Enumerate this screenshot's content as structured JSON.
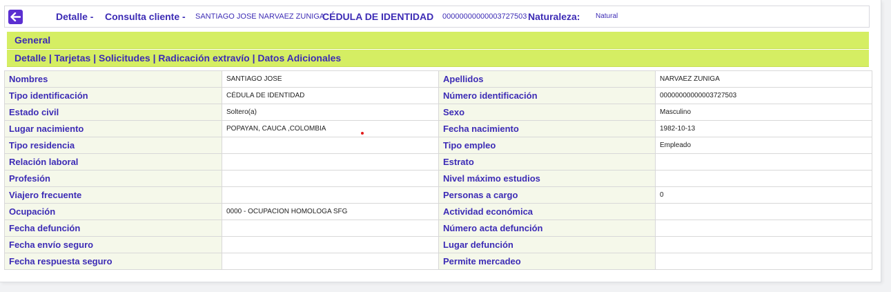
{
  "header": {
    "detalle": "Detalle -",
    "consulta": "Consulta cliente -",
    "client_name": "SANTIAGO JOSE NARVAEZ ZUNIGA",
    "doc_type": "CÉDULA DE IDENTIDAD",
    "doc_number": "00000000000003727503",
    "naturaleza_label": "Naturaleza:",
    "naturaleza_value": "Natural"
  },
  "sections": {
    "general": "General",
    "tabs": [
      "Detalle",
      "Tarjetas",
      "Solicitudes",
      "Radicación extravío",
      "Datos Adicionales"
    ],
    "separator": "|"
  },
  "rows": [
    {
      "l1": "Nombres",
      "v1": "SANTIAGO JOSE",
      "l2": "Apellidos",
      "v2": "NARVAEZ ZUNIGA"
    },
    {
      "l1": "Tipo identificación",
      "v1": "CÉDULA DE IDENTIDAD",
      "l2": "Número identificación",
      "v2": "00000000000003727503"
    },
    {
      "l1": "Estado civil",
      "v1": "Soltero(a)",
      "l2": "Sexo",
      "v2": "Masculino"
    },
    {
      "l1": "Lugar nacimiento",
      "v1": "POPAYAN, CAUCA ,COLOMBIA",
      "l2": "Fecha nacimiento",
      "v2": "1982-10-13"
    },
    {
      "l1": "Tipo residencia",
      "v1": "",
      "l2": "Tipo empleo",
      "v2": "Empleado"
    },
    {
      "l1": "Relación laboral",
      "v1": "",
      "l2": "Estrato",
      "v2": ""
    },
    {
      "l1": "Profesión",
      "v1": "",
      "l2": "Nivel máximo estudios",
      "v2": ""
    },
    {
      "l1": "Viajero frecuente",
      "v1": "",
      "l2": "Personas a cargo",
      "v2": "0"
    },
    {
      "l1": "Ocupación",
      "v1": "0000 - OCUPACION HOMOLOGA SFG",
      "l2": "Actividad económica",
      "v2": ""
    },
    {
      "l1": "Fecha defunción",
      "v1": "",
      "l2": "Número acta defunción",
      "v2": ""
    },
    {
      "l1": "Fecha envío seguro",
      "v1": "",
      "l2": "Lugar defunción",
      "v2": ""
    },
    {
      "l1": "Fecha respuesta seguro",
      "v1": "",
      "l2": "Permite mercadeo",
      "v2": ""
    }
  ],
  "colors": {
    "accent": "#3c2bb5",
    "band": "#d5ee63",
    "label_bg": "#f5f8ea",
    "back_button": "#5b2fd1"
  },
  "icons": {
    "back": "arrow-left-icon"
  }
}
